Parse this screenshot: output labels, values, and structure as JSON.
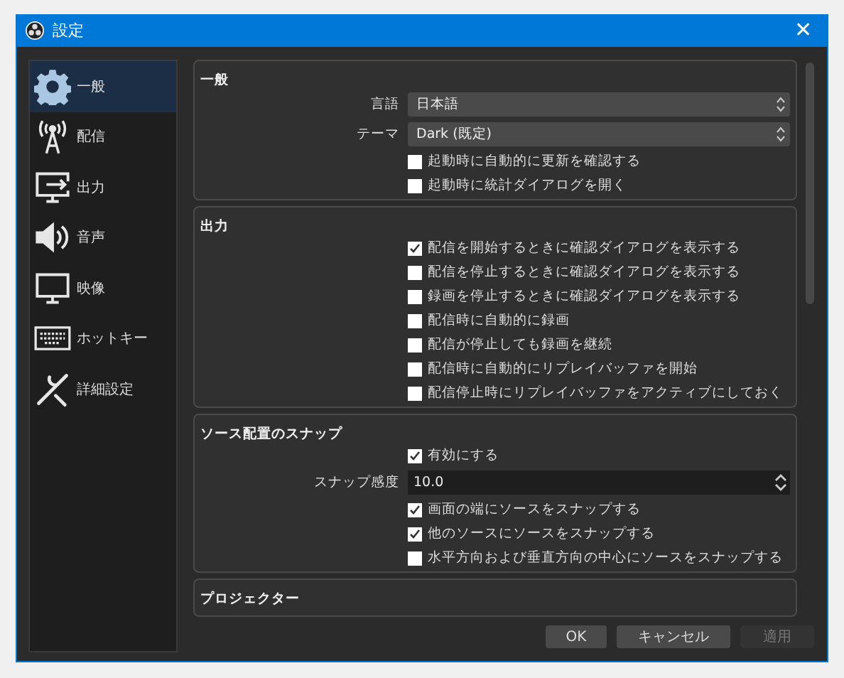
{
  "window": {
    "title": "設定",
    "close": "✕"
  },
  "sidebar": {
    "items": [
      {
        "label": "一般",
        "selected": true
      },
      {
        "label": "配信",
        "selected": false
      },
      {
        "label": "出力",
        "selected": false
      },
      {
        "label": "音声",
        "selected": false
      },
      {
        "label": "映像",
        "selected": false
      },
      {
        "label": "ホットキー",
        "selected": false
      },
      {
        "label": "詳細設定",
        "selected": false
      }
    ]
  },
  "sections": [
    {
      "title": "一般",
      "rows": [
        {
          "kind": "select",
          "label": "言語",
          "value": "日本語"
        },
        {
          "kind": "select",
          "label": "テーマ",
          "value": "Dark (既定)"
        },
        {
          "kind": "checkbox",
          "label": "起動時に自動的に更新を確認する",
          "checked": false
        },
        {
          "kind": "checkbox",
          "label": "起動時に統計ダイアログを開く",
          "checked": false
        }
      ]
    },
    {
      "title": "出力",
      "rows": [
        {
          "kind": "checkbox",
          "label": "配信を開始するときに確認ダイアログを表示する",
          "checked": true
        },
        {
          "kind": "checkbox",
          "label": "配信を停止するときに確認ダイアログを表示する",
          "checked": false
        },
        {
          "kind": "checkbox",
          "label": "録画を停止するときに確認ダイアログを表示する",
          "checked": false
        },
        {
          "kind": "checkbox",
          "label": "配信時に自動的に録画",
          "checked": false
        },
        {
          "kind": "checkbox",
          "label": "配信が停止しても録画を継続",
          "checked": false
        },
        {
          "kind": "checkbox",
          "label": "配信時に自動的にリプレイバッファを開始",
          "checked": false
        },
        {
          "kind": "checkbox",
          "label": "配信停止時にリプレイバッファをアクティブにしておく",
          "checked": false
        }
      ]
    },
    {
      "title": "ソース配置のスナップ",
      "rows": [
        {
          "kind": "checkbox",
          "label": "有効にする",
          "checked": true
        },
        {
          "kind": "spinbox",
          "label": "スナップ感度",
          "value": "10.0"
        },
        {
          "kind": "checkbox",
          "label": "画面の端にソースをスナップする",
          "checked": true
        },
        {
          "kind": "checkbox",
          "label": "他のソースにソースをスナップする",
          "checked": true
        },
        {
          "kind": "checkbox",
          "label": "水平方向および垂直方向の中心にソースをスナップする",
          "checked": false
        }
      ]
    },
    {
      "title": "プロジェクター"
    }
  ],
  "buttons": [
    {
      "label": "OK",
      "disabled": false
    },
    {
      "label": "キャンセル",
      "disabled": false
    },
    {
      "label": "適用",
      "disabled": true
    }
  ]
}
